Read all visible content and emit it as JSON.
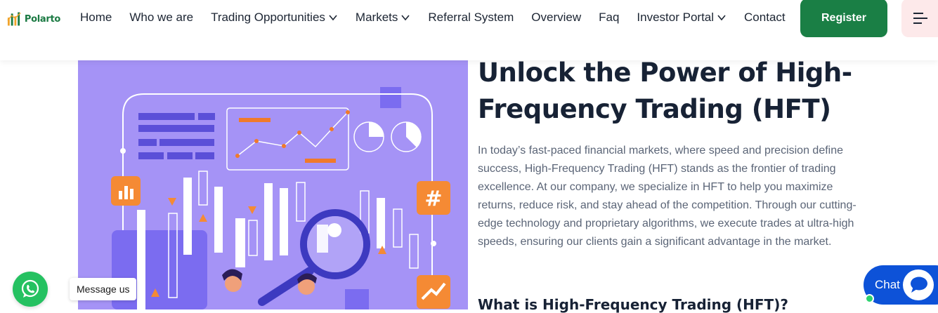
{
  "brand": {
    "name": "Polarto",
    "accent": "#1a7f45"
  },
  "nav": {
    "items": [
      {
        "label": "Home"
      },
      {
        "label": "Who we are"
      },
      {
        "label": "Trading Opportunities",
        "has_dropdown": true
      },
      {
        "label": "Markets",
        "has_dropdown": true
      },
      {
        "label": "Referral System"
      },
      {
        "label": "Overview"
      },
      {
        "label": "Faq"
      },
      {
        "label": "Investor Portal",
        "has_dropdown": true
      },
      {
        "label": "Contact"
      }
    ],
    "register_label": "Register",
    "menu_icon": "hamburger-menu-icon"
  },
  "hero": {
    "title": "Unlock the Power of High-Frequency Trading (HFT)",
    "paragraph": "In today’s fast-paced financial markets, where speed and precision define success, High-Frequency Trading (HFT) stands as the frontier of trading excellence. At our company, we specialize in HFT to help you maximize returns, reduce risk, and stay ahead of the competition. Through our cutting-edge technology and proprietary algorithms, we execute trades at ultra-high speeds, ensuring our clients gain a significant advantage in the market.",
    "subheading": "What is High-Frequency Trading (HFT)?",
    "illustration_bg": "#a593f6"
  },
  "widgets": {
    "whatsapp_label": "Message us",
    "chat_label": "Chat"
  }
}
